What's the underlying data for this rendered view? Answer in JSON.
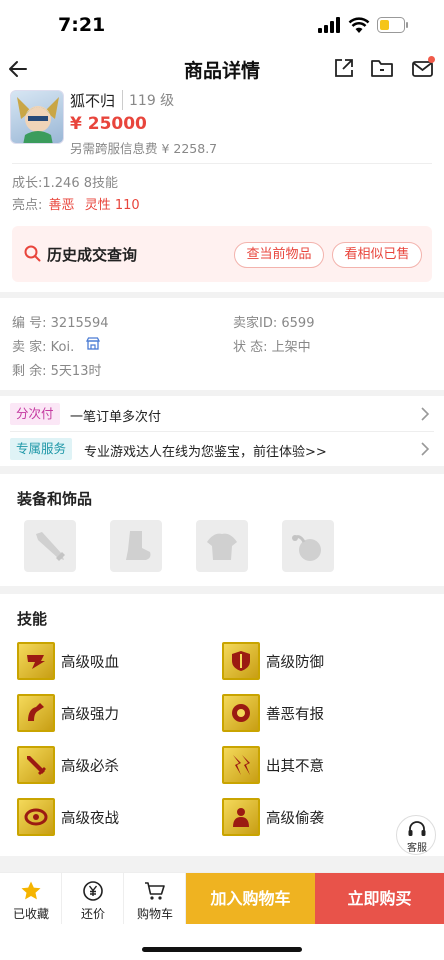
{
  "status_bar": {
    "time": "7:21"
  },
  "nav": {
    "title": "商品详情"
  },
  "item": {
    "name": "狐不归",
    "level": "119 级",
    "price": "¥ 25000",
    "cross_server_fee": "另需跨服信息费 ¥ 2258.7",
    "growth": "成长:1.246 8技能",
    "highlight_label": "亮点:",
    "highlight_tags": [
      "善恶",
      "灵性 110"
    ]
  },
  "history": {
    "title": "历史成交查询",
    "btn_current": "查当前物品",
    "btn_similar": "看相似已售"
  },
  "info": {
    "serial_label": "编 号:",
    "serial_value": "3215594",
    "seller_id_label": "卖家ID:",
    "seller_id_value": "6599",
    "seller_label": "卖 家:",
    "seller_value": "Koi.",
    "status_label": "状 态:",
    "status_value": "上架中",
    "remaining_label": "剩 余:",
    "remaining_value": "5天13时"
  },
  "installment": {
    "tag": "分次付",
    "text": "一笔订单多次付"
  },
  "service": {
    "tag": "专属服务",
    "text": "专业游戏达人在线为您鉴宝，前往体验>>"
  },
  "equipment": {
    "title": "装备和饰品",
    "slots": [
      "weapon-icon",
      "boots-icon",
      "armor-icon",
      "accessory-icon"
    ]
  },
  "skills": {
    "title": "技能",
    "items": [
      {
        "label": "高级吸血"
      },
      {
        "label": "高级防御"
      },
      {
        "label": "高级强力"
      },
      {
        "label": "善恶有报"
      },
      {
        "label": "高级必杀"
      },
      {
        "label": "出其不意"
      },
      {
        "label": "高级夜战"
      },
      {
        "label": "高级偷袭"
      }
    ]
  },
  "customer_service": {
    "label": "客服"
  },
  "bottom_bar": {
    "favorite": "已收藏",
    "bargain": "还价",
    "cart": "购物车",
    "add_to_cart": "加入购物车",
    "buy_now": "立即购买"
  },
  "colors": {
    "accent_red": "#e8453c",
    "cart_yellow": "#efb321",
    "buy_red": "#e8534a"
  }
}
